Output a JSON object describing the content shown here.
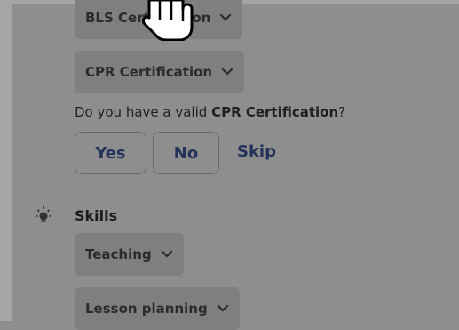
{
  "certifications": {
    "items": [
      {
        "label": "BLS Certification"
      },
      {
        "label": "CPR Certification"
      }
    ],
    "question": {
      "prefix": "Do you have a valid ",
      "emphasis": "CPR Certification",
      "suffix": "?"
    },
    "answers": {
      "yes": "Yes",
      "no": "No",
      "skip": "Skip"
    }
  },
  "skills": {
    "title": "Skills",
    "items": [
      {
        "label": "Teaching"
      },
      {
        "label": "Lesson planning"
      }
    ]
  },
  "icons": {
    "chevron": "chevron-down-icon",
    "skills": "lightbulb-icon",
    "cursor": "hand-pointer-icon"
  },
  "colors": {
    "background": "#8e8e8e",
    "chip": "#7f7f7f",
    "accent_text": "#22325a"
  }
}
